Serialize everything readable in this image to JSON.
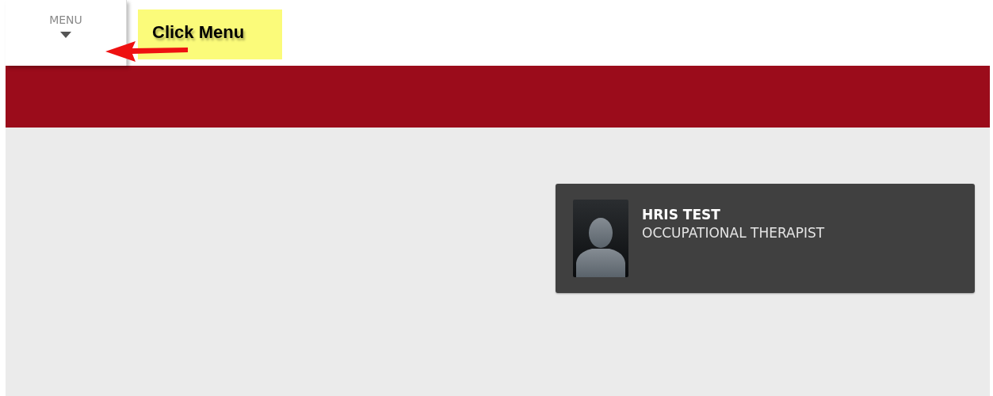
{
  "header": {
    "menu_button": {
      "label": "MENU"
    }
  },
  "annotation": {
    "text": "Click Menu"
  },
  "profile_card": {
    "name": "HRIS TEST",
    "title": "OCCUPATIONAL THERAPIST"
  }
}
